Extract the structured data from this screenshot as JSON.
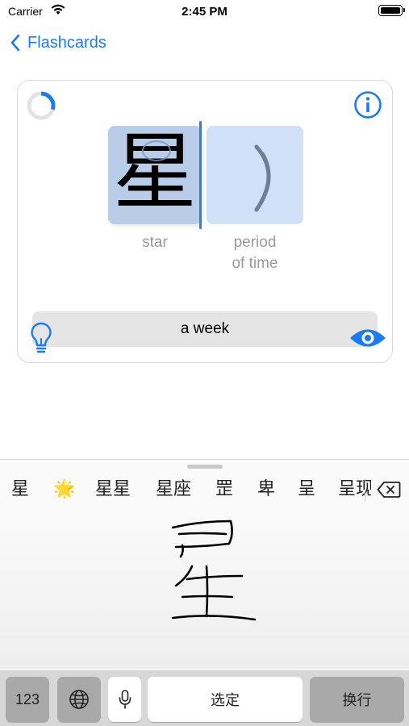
{
  "status_bar": {
    "carrier": "Carrier",
    "time": "2:45 PM"
  },
  "nav": {
    "back_label": "Flashcards"
  },
  "card": {
    "progress_fraction": 0.3,
    "character": "星",
    "components": [
      {
        "gloss": "star"
      },
      {
        "gloss": "period\nof time"
      }
    ],
    "answer": "a week"
  },
  "keyboard": {
    "candidates": [
      "星",
      "🌟",
      "星星",
      "星座",
      "罡",
      "卑",
      "呈",
      "呈现"
    ],
    "keys": {
      "numbers": "123",
      "space": "选定",
      "return": "换行"
    }
  },
  "colors": {
    "accent": "#1a7cf0",
    "tile": "#cfe0f7",
    "tile_selected": "#b9cde8"
  }
}
